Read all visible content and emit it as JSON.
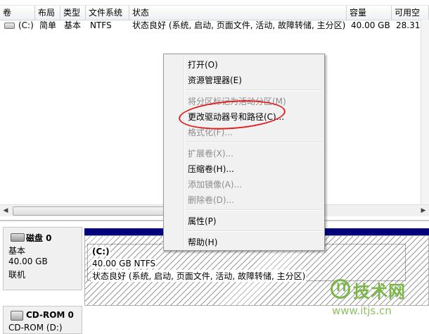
{
  "table": {
    "columns": [
      "卷",
      "布局",
      "类型",
      "文件系统",
      "状态",
      "容量",
      "可用空"
    ],
    "row": {
      "volume": "(C:)",
      "layout": "简单",
      "type": "基本",
      "fs": "NTFS",
      "status": "状态良好 (系统, 启动, 页面文件, 活动, 故障转储, 主分区)",
      "capacity": "40.00 GB",
      "free": "28.31"
    }
  },
  "disks": {
    "disk0": {
      "name": "磁盘 0",
      "type": "基本",
      "size": "40.00 GB",
      "state": "联机",
      "partition": {
        "label": "(C:)",
        "size_fs": "40.00 GB NTFS",
        "status": "状态良好 (系统, 启动, 页面文件, 活动, 故障转储, 主分区)"
      }
    },
    "cdrom0": {
      "name": "CD-ROM 0",
      "sub": "CD-ROM (D:)"
    }
  },
  "context_menu": {
    "items": [
      {
        "label": "打开(O)",
        "enabled": true
      },
      {
        "label": "资源管理器(E)",
        "enabled": true
      },
      {
        "label": "将分区标记为活动分区(M)",
        "enabled": false
      },
      {
        "label": "更改驱动器号和路径(C)...",
        "enabled": true,
        "highlighted_by_annotation": true
      },
      {
        "label": "格式化(F)...",
        "enabled": false
      },
      {
        "label": "扩展卷(X)...",
        "enabled": false
      },
      {
        "label": "压缩卷(H)...",
        "enabled": true
      },
      {
        "label": "添加镜像(A)...",
        "enabled": false
      },
      {
        "label": "删除卷(D)...",
        "enabled": false
      },
      {
        "label": "属性(P)",
        "enabled": true
      },
      {
        "label": "帮助(H)",
        "enabled": true
      }
    ]
  },
  "scrollbar": {
    "left_arrow": "◀",
    "right_arrow": "▶"
  },
  "watermark": {
    "title": "技术网",
    "url": "www.itjs.cn"
  },
  "colors": {
    "partition_bar": "#00007b",
    "annotation": "#e02020",
    "watermark": "#7ab648"
  }
}
